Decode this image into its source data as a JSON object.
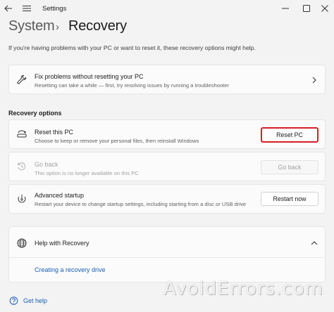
{
  "window": {
    "title": "Settings"
  },
  "breadcrumb": {
    "parent": "System",
    "separator": "›",
    "current": "Recovery"
  },
  "intro_text": "If you're having problems with your PC or want to reset it, these recovery options might help.",
  "fix_card": {
    "title": "Fix problems without resetting your PC",
    "subtitle": "Resetting can take a while — first, try resolving issues by running a troubleshooter",
    "icon": "wrench-icon"
  },
  "recovery_options": {
    "heading": "Recovery options",
    "items": [
      {
        "title": "Reset this PC",
        "subtitle": "Choose to keep or remove your personal files, then reinstall Windows",
        "button": "Reset PC",
        "icon": "reset-pc-icon",
        "enabled": true,
        "highlighted": true
      },
      {
        "title": "Go back",
        "subtitle": "This option is no longer available on this PC",
        "button": "Go back",
        "icon": "history-icon",
        "enabled": false
      },
      {
        "title": "Advanced startup",
        "subtitle": "Restart your device to change startup settings, including starting from a disc or USB drive",
        "button": "Restart now",
        "icon": "advanced-startup-icon",
        "enabled": true
      }
    ]
  },
  "help_section": {
    "title": "Help with Recovery",
    "link": "Creating a recovery drive",
    "icon": "globe-icon",
    "expanded": true
  },
  "footer": {
    "get_help": "Get help"
  },
  "watermark": "AvoidErrors.com",
  "colors": {
    "accent": "#1a5fb4",
    "highlight": "#d32027",
    "background": "#f3f3f3"
  }
}
